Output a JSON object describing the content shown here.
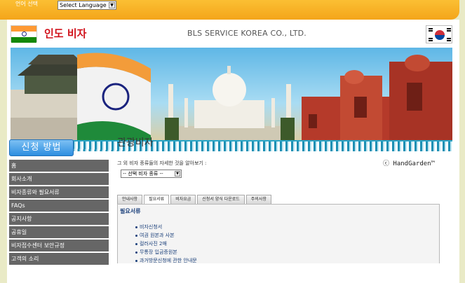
{
  "topbar": {
    "language_label": "언어 선택",
    "language_select": "Select Language"
  },
  "header": {
    "title": "인도 비자",
    "company": "BLS SERVICE KOREA CO., LTD."
  },
  "sidebar": {
    "howto_label": "신청 방법",
    "items": [
      {
        "label": "홈"
      },
      {
        "label": "회사소개"
      },
      {
        "label": "비자종류와 필요서류"
      },
      {
        "label": "FAQs"
      },
      {
        "label": "공지사항"
      },
      {
        "label": "공휴일"
      },
      {
        "label": "비자접수센터 보안규정"
      },
      {
        "label": "고객의 소리"
      }
    ]
  },
  "main": {
    "title": "관광비자",
    "watermark": "ⓒ HandGarden™",
    "hint": "그 외 비자 종류들의 자세한 것을 알아보기 :",
    "visa_select": "-- 선택 비자 종류 --",
    "tabs": [
      {
        "label": "안내사항",
        "active": false
      },
      {
        "label": "필요서류",
        "active": true
      },
      {
        "label": "비자요금",
        "active": false
      },
      {
        "label": "신청서 양식 다운로드",
        "active": false
      },
      {
        "label": "주의사항",
        "active": false
      }
    ],
    "panel_title": "필요서류",
    "requirements": [
      "비자신청서",
      "여권 원본과 사본",
      "컬러사진 2매",
      "무통장 입금증원본",
      "과거방문신청에 관한 안내문"
    ]
  },
  "colors": {
    "topbar": "#f4a51a",
    "title_red": "#d1121b",
    "nav_gray": "#666666",
    "howto_blue": "#2d8ee0",
    "link_blue": "#1a3f7a"
  }
}
